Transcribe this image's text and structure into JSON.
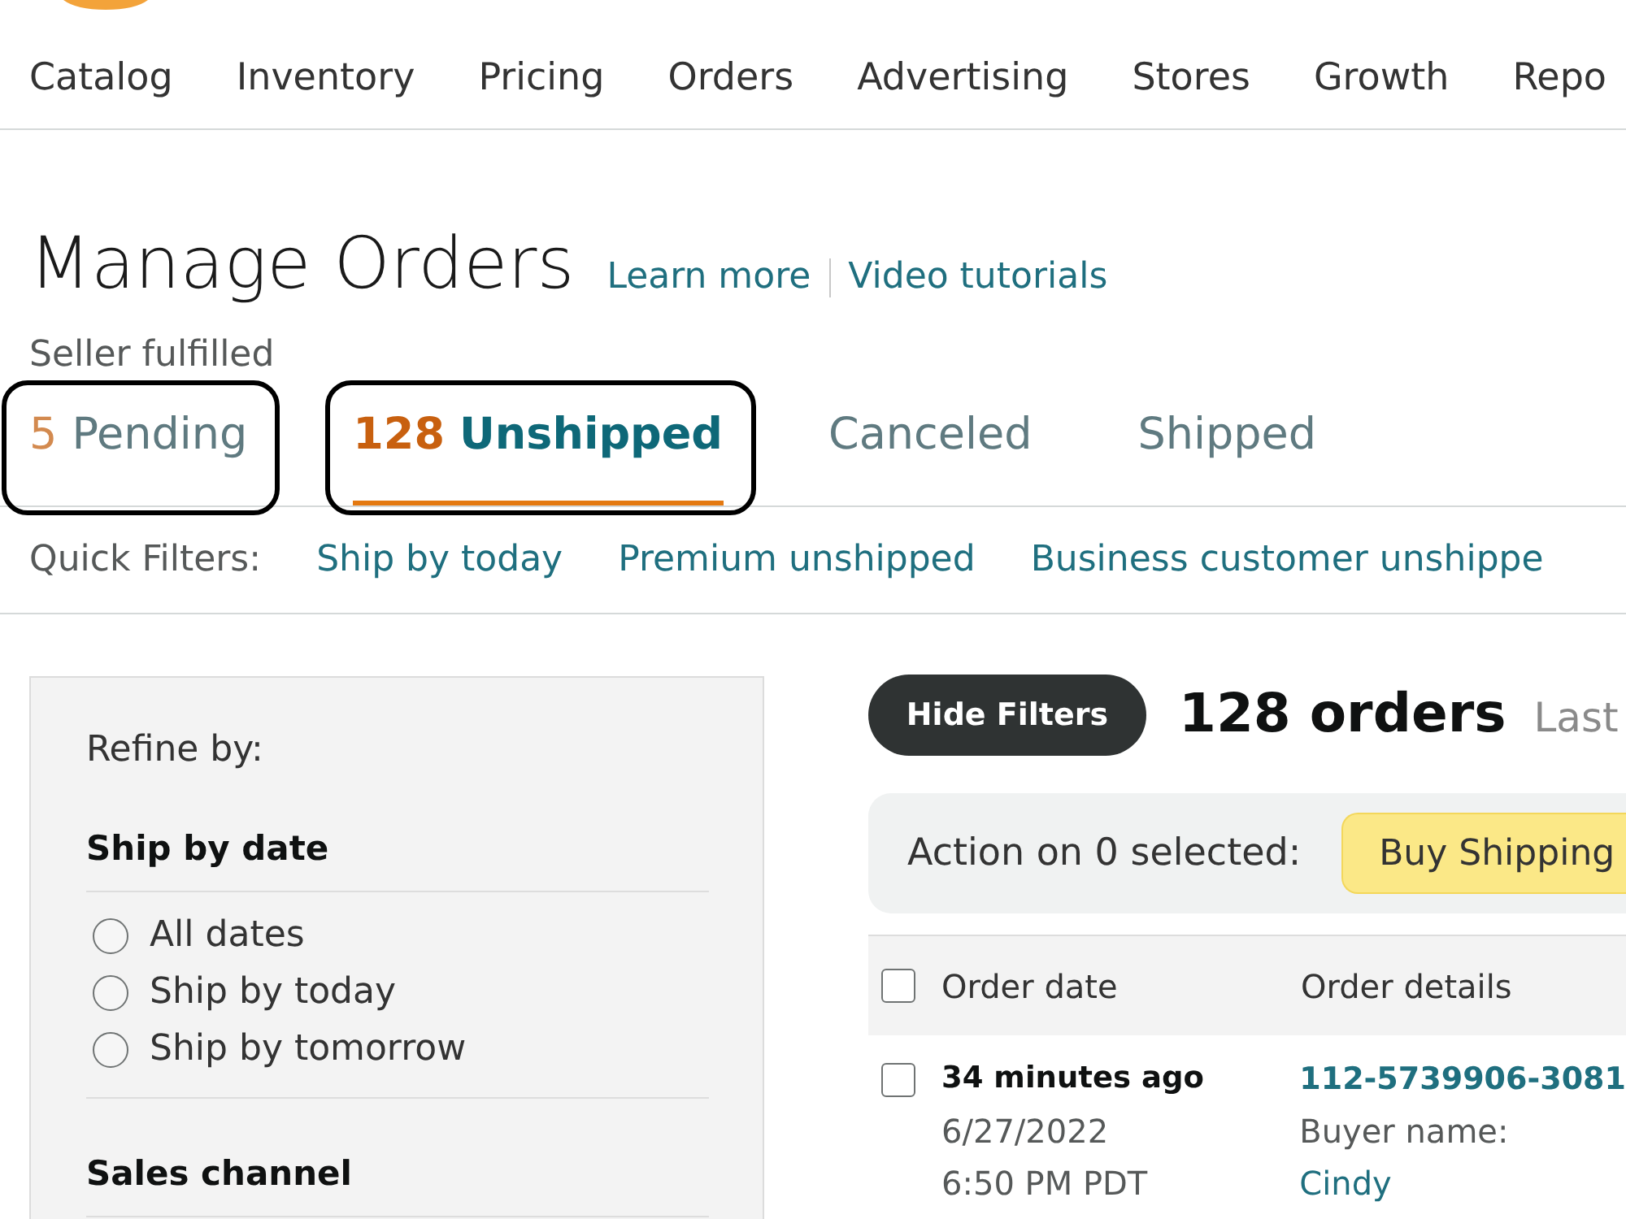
{
  "nav_items": [
    "Catalog",
    "Inventory",
    "Pricing",
    "Orders",
    "Advertising",
    "Stores",
    "Growth",
    "Repo"
  ],
  "header": {
    "title": "Manage Orders",
    "links": [
      "Learn more",
      "Video tutorials"
    ],
    "subtitle": "Seller fulfilled"
  },
  "tabs": [
    {
      "count": "5",
      "label": "Pending",
      "selected": false,
      "highlighted": true
    },
    {
      "count": "128",
      "label": "Unshipped",
      "selected": true,
      "highlighted": true
    },
    {
      "label": "Canceled",
      "selected": false,
      "highlighted": false
    },
    {
      "label": "Shipped",
      "selected": false,
      "highlighted": false
    }
  ],
  "quick_filters": {
    "label": "Quick Filters:",
    "items": [
      "Ship by today",
      "Premium unshipped",
      "Business customer unshippe"
    ]
  },
  "refine_panel": {
    "title": "Refine by:",
    "sections": [
      {
        "heading": "Ship by date",
        "options": [
          {
            "label": "All dates",
            "selected": false
          },
          {
            "label": "Ship by today",
            "selected": false
          },
          {
            "label": "Ship by tomorrow",
            "selected": false
          }
        ]
      },
      {
        "heading": "Sales channel"
      }
    ]
  },
  "results": {
    "toggle_button": "Hide Filters",
    "count": "128 orders",
    "period": "Last"
  },
  "action_bar": {
    "label": "Action on 0 selected:",
    "buttons": [
      "Buy Shipping"
    ]
  },
  "table": {
    "select_all": {
      "checked": false
    },
    "columns": [
      "Order date",
      "Order details"
    ],
    "rows": [
      {
        "checked": false,
        "order_date": {
          "age": "34 minutes ago",
          "date": "6/27/2022",
          "time": "6:50 PM PDT"
        },
        "order_details": {
          "order_id": "112-5739906-3081",
          "buyer_label": "Buyer name:",
          "buyer_name": "Cindy"
        }
      }
    ]
  }
}
